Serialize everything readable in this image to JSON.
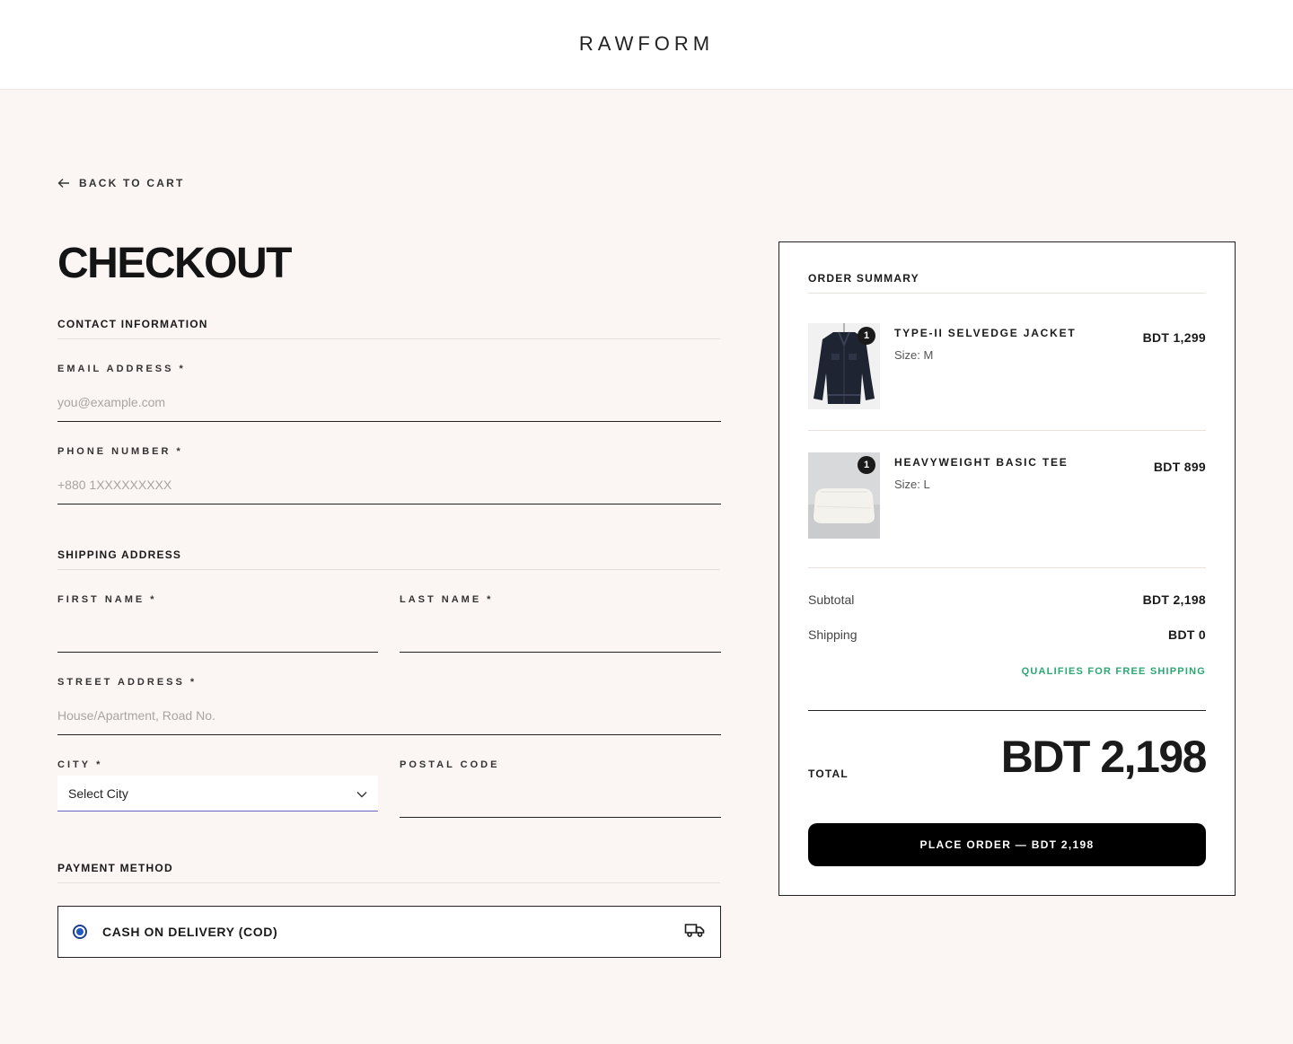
{
  "header": {
    "brand": "RAWFORM"
  },
  "nav": {
    "back_label": "BACK TO CART"
  },
  "page": {
    "title": "CHECKOUT"
  },
  "contact": {
    "section_title": "CONTACT INFORMATION",
    "email": {
      "label": "EMAIL ADDRESS",
      "required_mark": "*",
      "value": "",
      "placeholder": "you@example.com"
    },
    "phone": {
      "label": "PHONE NUMBER",
      "required_mark": "*",
      "value": "",
      "placeholder": "+880 1XXXXXXXXX"
    }
  },
  "shipping": {
    "section_title": "SHIPPING ADDRESS",
    "first_name": {
      "label": "FIRST NAME",
      "required_mark": "*",
      "value": "",
      "placeholder": ""
    },
    "last_name": {
      "label": "LAST NAME",
      "required_mark": "*",
      "value": "",
      "placeholder": ""
    },
    "street": {
      "label": "STREET ADDRESS",
      "required_mark": "*",
      "value": "",
      "placeholder": "House/Apartment, Road No."
    },
    "city": {
      "label": "CITY",
      "required_mark": "*",
      "selected": "Select City"
    },
    "postal": {
      "label": "POSTAL CODE",
      "value": "",
      "placeholder": ""
    }
  },
  "payment": {
    "section_title": "PAYMENT METHOD",
    "option_label": "CASH ON DELIVERY (COD)",
    "selected": true,
    "icon": "truck-icon"
  },
  "summary": {
    "title": "ORDER SUMMARY",
    "items": [
      {
        "name": "TYPE-II SELVEDGE JACKET",
        "size": "Size: M",
        "price": "BDT 1,299",
        "qty": "1",
        "thumb": "denim-jacket"
      },
      {
        "name": "HEAVYWEIGHT BASIC TEE",
        "size": "Size: L",
        "price": "BDT 899",
        "qty": "1",
        "thumb": "white-tee"
      }
    ],
    "subtotal_label": "Subtotal",
    "subtotal_value": "BDT 2,198",
    "shipping_label": "Shipping",
    "shipping_value": "BDT 0",
    "free_shipping_note": "QUALIFIES FOR FREE SHIPPING",
    "total_label": "TOTAL",
    "total_value": "BDT 2,198",
    "place_order_label": "PLACE ORDER — BDT 2,198"
  },
  "colors": {
    "page_bg": "#fbf6f4",
    "accent_green": "#2aa872",
    "radio_blue": "#2058c6",
    "button_bg": "#000000"
  }
}
